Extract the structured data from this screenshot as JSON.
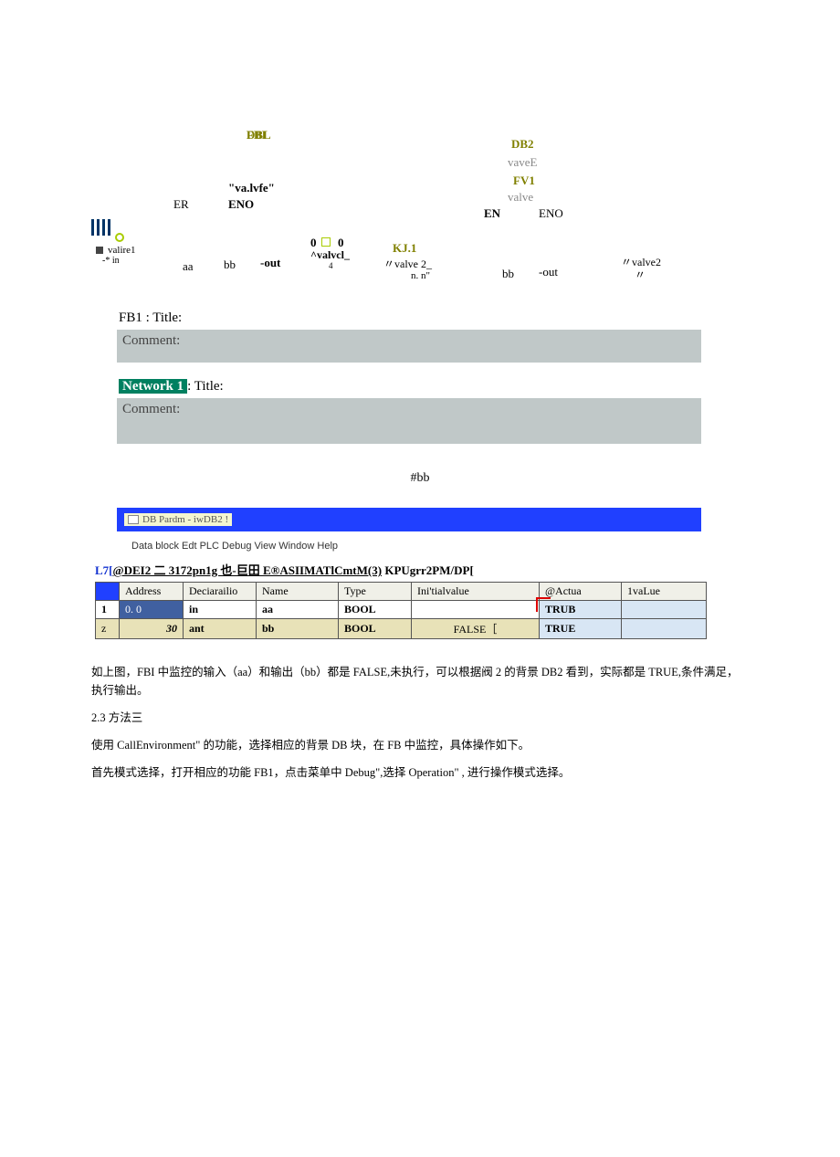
{
  "fbLeft": {
    "dbl": "DBL",
    "fbi": "FBI",
    "valvfe": "\"va.lvfe\"",
    "er": "ER",
    "eno": "ENO",
    "valirel": "valire1",
    "starIn": "-* in",
    "aa": "aa",
    "bbLabel": "bb",
    "out": "-out",
    "zeroSq": "0",
    "zero2": "0",
    "valvcl": "^valvcl_",
    "four": "4"
  },
  "fbRight": {
    "db2": "DB2",
    "vaveE": "vaveE",
    "fv1": "FV1",
    "valve": "valve",
    "en": "EN",
    "eno": "ENO",
    "kj1": "KJ.1",
    "valve2Top": "〃valve 2_",
    "nn": "n. n\"",
    "bbLabel": "bb",
    "out": "-out",
    "valve2R": "〃valve2",
    "closeQ": "〃"
  },
  "fb1": {
    "titleLabel": "FB1 : Title:",
    "commentLabel": "Comment:",
    "networkBadge": "Network 1",
    "networkTitle": ": Title:",
    "comment2": "Comment:"
  },
  "hashbb": "#bb",
  "blueBar": "DB Pardm - iwDB2    !",
  "dbMenu": "Data block Edt PLC Debug View Window Help",
  "pathLine": {
    "l7": "L7[",
    "part1": "@DEI2 二 3172pn1g 也-巨田 E®ASIIMATlCmtM(3)",
    "part2": " KPUgrr2PM/DP["
  },
  "table": {
    "headers": [
      "",
      "Address",
      "Deciarailio",
      "Name",
      "Type",
      "Ini'tialvalue",
      "@Actua",
      "1vaLue"
    ],
    "rows": [
      {
        "idx": "1",
        "addr": "0. 0",
        "decl": "in",
        "name": "aa",
        "type": "BOOL",
        "init": "",
        "actual": "TRUB",
        "val": ""
      },
      {
        "idx": "z",
        "addr": "30",
        "decl": "ant",
        "name": "bb",
        "type": "BOOL",
        "init": "FALSE［",
        "actual": "TRUE",
        "val": ""
      }
    ]
  },
  "bodyText": {
    "p1": "如上图，FBI 中监控的输入（aa）和输出（bb）都是 FALSE,未执行，可以根据阀 2 的背景 DB2 看到，实际都是 TRUE,条件满足，执行输出。",
    "p2a": "2.3 方法三",
    "p3": "使用 CallEnvironment\" 的功能，选择相应的背景 DB 块，在 FB 中监控，具体操作如下。",
    "p4": "首先模式选择，打开相应的功能 FB1，点击菜单中 Debug\",选择 Operation\" , 进行操作模式选择。"
  }
}
